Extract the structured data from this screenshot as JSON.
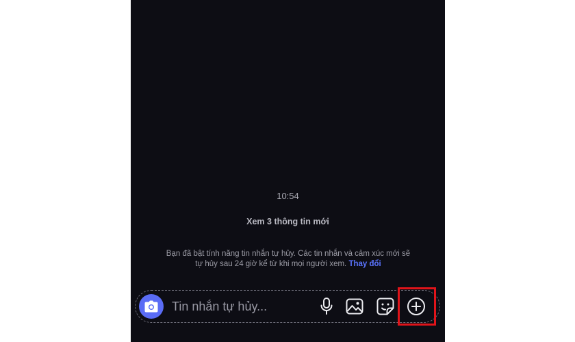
{
  "chat": {
    "timestamp": "10:54",
    "new_info": "Xem 3 thông tin mới",
    "notice_text": "Bạn đã bật tính năng tin nhắn tự hủy. Các tin nhắn và cảm xúc mới sẽ tự hủy sau 24 giờ kể từ khi mọi người xem.",
    "notice_link": "Thay đổi"
  },
  "composer": {
    "placeholder": "Tin nhắn tự hủy...",
    "icons": [
      "camera-icon",
      "microphone-icon",
      "image-icon",
      "sticker-icon",
      "plus-circle-icon"
    ]
  },
  "colors": {
    "background": "#0d0d14",
    "accent": "#5a6cf5",
    "link": "#5b74ff",
    "highlight": "#e0141a"
  }
}
